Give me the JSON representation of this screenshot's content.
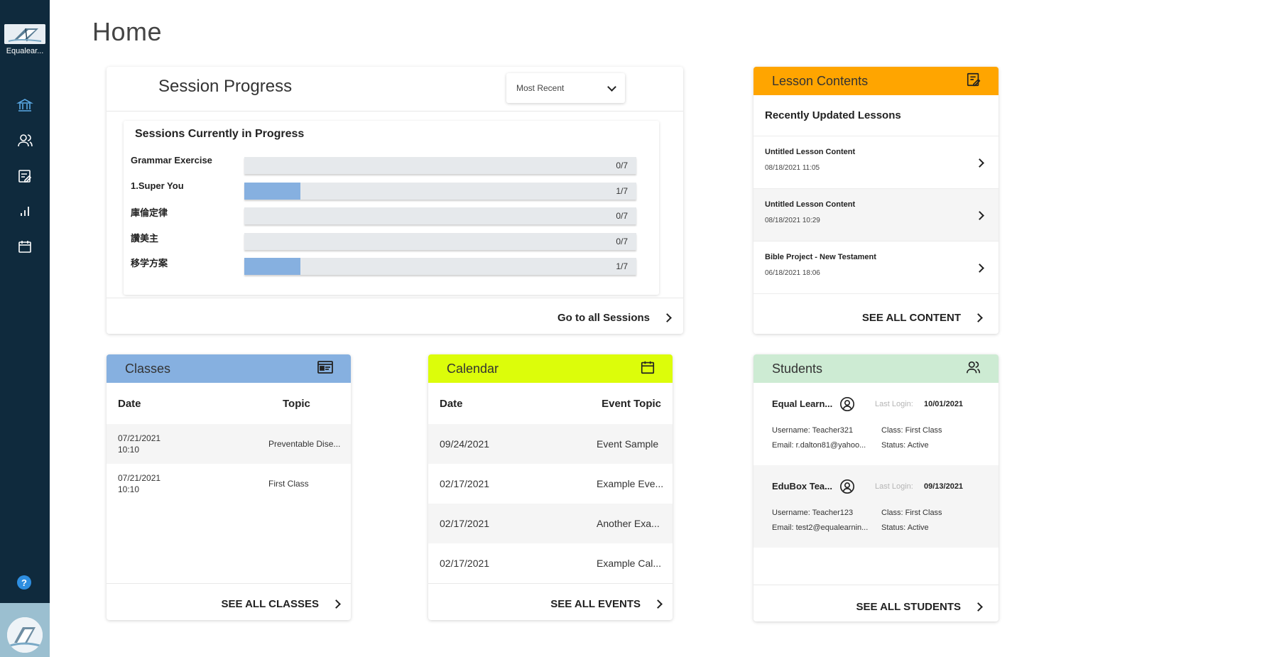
{
  "sidebar": {
    "brand": "Equalear...",
    "nav": [
      {
        "icon": "bank-icon",
        "name": "nav-home"
      },
      {
        "icon": "users-icon",
        "name": "nav-users"
      },
      {
        "icon": "edit-list-icon",
        "name": "nav-lessons"
      },
      {
        "icon": "bar-chart-icon",
        "name": "nav-reports"
      },
      {
        "icon": "calendar-icon",
        "name": "nav-calendar"
      }
    ],
    "help": "?"
  },
  "page": {
    "title": "Home"
  },
  "session_progress": {
    "title": "Session Progress",
    "dropdown": "Most Recent",
    "inner_title": "Sessions Currently in Progress",
    "rows": [
      {
        "label": "Grammar Exercise",
        "count": "0/7",
        "progress": 0.0
      },
      {
        "label": "1.Super You",
        "count": "1/7",
        "progress": 0.143
      },
      {
        "label": "庫倫定律",
        "count": "0/7",
        "progress": 0.0
      },
      {
        "label": "讚美主",
        "count": "0/7",
        "progress": 0.0
      },
      {
        "label": "移学方案",
        "count": "1/7",
        "progress": 0.143
      }
    ],
    "footer": "Go to all Sessions"
  },
  "lesson_contents": {
    "title": "Lesson Contents",
    "color": "#ffa500",
    "subtitle": "Recently Updated Lessons",
    "items": [
      {
        "name": "Untitled Lesson Content",
        "date": "08/18/2021 11:05"
      },
      {
        "name": "Untitled Lesson Content",
        "date": "08/18/2021 10:29"
      },
      {
        "name": "Bible Project - New Testament",
        "date": "06/18/2021 18:06"
      }
    ],
    "footer": "SEE ALL CONTENT"
  },
  "classes": {
    "title": "Classes",
    "color": "#86b0e0",
    "col_date": "Date",
    "col_topic": "Topic",
    "rows": [
      {
        "date": "07/21/2021",
        "time": "10:10",
        "topic": "Preventable Dise..."
      },
      {
        "date": "07/21/2021",
        "time": "10:10",
        "topic": "First Class"
      }
    ],
    "footer": "SEE ALL CLASSES"
  },
  "calendar": {
    "title": "Calendar",
    "color": "#dcfd0a",
    "col_date": "Date",
    "col_topic": "Event Topic",
    "rows": [
      {
        "date": "09/24/2021",
        "topic": "Event Sample"
      },
      {
        "date": "02/17/2021",
        "topic": "Example Eve..."
      },
      {
        "date": "02/17/2021",
        "topic": "Another Exa..."
      },
      {
        "date": "02/17/2021",
        "topic": "Example Cal..."
      }
    ],
    "footer": "SEE ALL EVENTS"
  },
  "students": {
    "title": "Students",
    "color": "#cdebd3",
    "last_login_label": "Last Login:",
    "items": [
      {
        "name": "Equal Learn...",
        "last_login": "10/01/2021",
        "username": "Username: Teacher321",
        "class": "Class: First Class",
        "email": "Email: r.dalton81@yahoo...",
        "status": "Status: Active"
      },
      {
        "name": "EduBox Tea...",
        "last_login": "09/13/2021",
        "username": "Username: Teacher123",
        "class": "Class: First Class",
        "email": "Email: test2@equalearnin...",
        "status": "Status: Active"
      }
    ],
    "footer": "SEE ALL STUDENTS"
  }
}
